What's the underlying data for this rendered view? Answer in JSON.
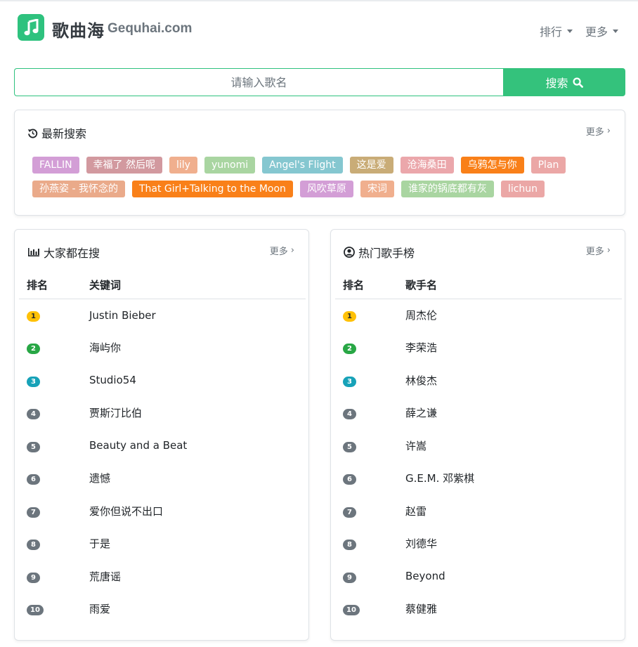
{
  "brand": {
    "name_cn": "歌曲海",
    "name_en": "Gequhai.com"
  },
  "nav": [
    {
      "label": "排行"
    },
    {
      "label": "更多"
    }
  ],
  "search": {
    "placeholder": "请输入歌名",
    "button_label": "搜索"
  },
  "recent": {
    "title": "最新搜索",
    "more": "更多",
    "rows": [
      [
        {
          "label": "FALLIN",
          "color": "#d39ed6"
        },
        {
          "label": "幸福了 然后呢",
          "color": "#d2999f"
        },
        {
          "label": "lily",
          "color": "#f0af8e"
        },
        {
          "label": "yunomi",
          "color": "#a9d5a1"
        },
        {
          "label": "Angel's Flight",
          "color": "#85c7d0"
        },
        {
          "label": "这是爱",
          "color": "#c9ac77"
        },
        {
          "label": "沧海桑田",
          "color": "#eba7ab"
        },
        {
          "label": "乌鸦怎与你",
          "color": "#f98019"
        },
        {
          "label": "Plan",
          "color": "#eba7a6"
        }
      ],
      [
        {
          "label": "孙燕姿 - 我怀念的",
          "color": "#eaaa8a"
        },
        {
          "label": "That Girl+Talking to the Moon",
          "color": "#f98019"
        },
        {
          "label": "风吹草原",
          "color": "#d39ed6"
        },
        {
          "label": "宋词",
          "color": "#f0af8e"
        },
        {
          "label": "谁家的锅底都有灰",
          "color": "#a9d5a1"
        },
        {
          "label": "lichun",
          "color": "#eba7a6"
        }
      ]
    ]
  },
  "popular": {
    "title": "大家都在搜",
    "more": "更多",
    "col_rank": "排名",
    "col_name": "关键词",
    "items": [
      {
        "rank": "1",
        "name": "Justin Bieber"
      },
      {
        "rank": "2",
        "name": "海屿你"
      },
      {
        "rank": "3",
        "name": "Studio54"
      },
      {
        "rank": "4",
        "name": "贾斯汀比伯"
      },
      {
        "rank": "5",
        "name": "Beauty and a Beat"
      },
      {
        "rank": "6",
        "name": "遗憾"
      },
      {
        "rank": "7",
        "name": "爱你但说不出口"
      },
      {
        "rank": "8",
        "name": "于是"
      },
      {
        "rank": "9",
        "name": "荒唐谣"
      },
      {
        "rank": "10",
        "name": "雨爱"
      }
    ]
  },
  "singers": {
    "title": "热门歌手榜",
    "more": "更多",
    "col_rank": "排名",
    "col_name": "歌手名",
    "items": [
      {
        "rank": "1",
        "name": "周杰伦"
      },
      {
        "rank": "2",
        "name": "李荣浩"
      },
      {
        "rank": "3",
        "name": "林俊杰"
      },
      {
        "rank": "4",
        "name": "薛之谦"
      },
      {
        "rank": "5",
        "name": "许嵩"
      },
      {
        "rank": "6",
        "name": "G.E.M. 邓紫棋"
      },
      {
        "rank": "7",
        "name": "赵雷"
      },
      {
        "rank": "8",
        "name": "刘德华"
      },
      {
        "rank": "9",
        "name": "Beyond"
      },
      {
        "rank": "10",
        "name": "蔡健雅"
      }
    ]
  },
  "badge_colors": [
    "#ffc107",
    "#28a745",
    "#17a2b8",
    "#6c757d",
    "#6c757d",
    "#6c757d",
    "#6c757d",
    "#6c757d",
    "#6c757d",
    "#6c757d"
  ],
  "accent": "#34c27c"
}
